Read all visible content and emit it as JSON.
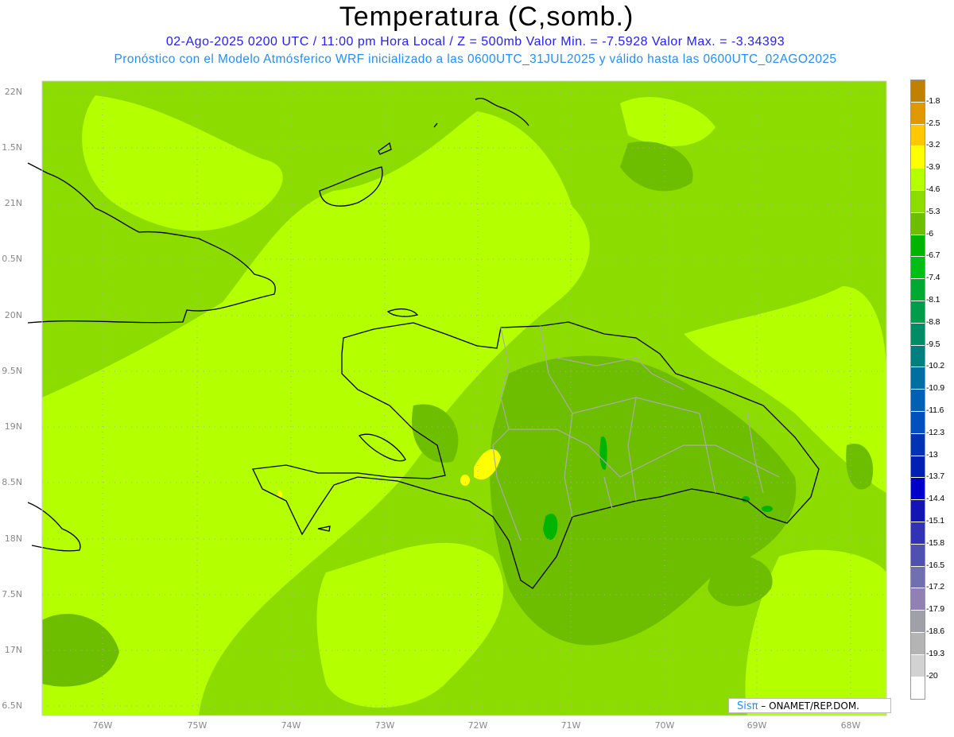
{
  "header": {
    "title": "Temperatura (C,somb.)",
    "line1": "02-Ago-2025  0200 UTC / 11:00 pm Hora Local / Z = 500mb   Valor Min. = -7.5928  Valor Max. = -3.34393",
    "line2": "Pronóstico con el Modelo Atmósferico WRF inicializado a las 0600UTC_31JUL2025 y válido hasta las  0600UTC_02AGO2025"
  },
  "axes": {
    "lat_labels": [
      "22N",
      "1.5N",
      "21N",
      "0.5N",
      "20N",
      "9.5N",
      "19N",
      "8.5N",
      "18N",
      "7.5N",
      "17N",
      "6.5N"
    ],
    "lon_labels": [
      "76W",
      "75W",
      "74W",
      "73W",
      "72W",
      "71W",
      "70W",
      "69W",
      "68W"
    ]
  },
  "colorbar": {
    "colors": [
      "#c08000",
      "#e09800",
      "#ffc800",
      "#ffff00",
      "#b4ff00",
      "#8cdc00",
      "#6ebe00",
      "#00b400",
      "#00be14",
      "#00aa32",
      "#009b4b",
      "#008c64",
      "#007f7f",
      "#006ea0",
      "#0060b4",
      "#0050be",
      "#0032b4",
      "#0020b4",
      "#0000c8",
      "#1414b4",
      "#3232b4",
      "#5050b0",
      "#7070b0",
      "#9080b4",
      "#a0a0a8",
      "#b4b4b4",
      "#d2d2d2",
      "#ffffff"
    ],
    "labels": [
      "-1.8",
      "-2.5",
      "-3.2",
      "-3.9",
      "-4.6",
      "-5.3",
      "-6",
      "-6.7",
      "-7.4",
      "-8.1",
      "-8.8",
      "-9.5",
      "-10.2",
      "-10.9",
      "-11.6",
      "-12.3",
      "-13",
      "-13.7",
      "-14.4",
      "-15.1",
      "-15.8",
      "-16.5",
      "-17.2",
      "-17.9",
      "-18.6",
      "-19.3",
      "-20"
    ]
  },
  "credit": {
    "logo": "Sisπ",
    "text": " – ONAMET/REP.DOM."
  },
  "field_colors": {
    "base": "#8cdc00",
    "light": "#b4ff00",
    "dark": "#6ebe00",
    "yellow": "#ffff00",
    "green": "#00b400"
  }
}
